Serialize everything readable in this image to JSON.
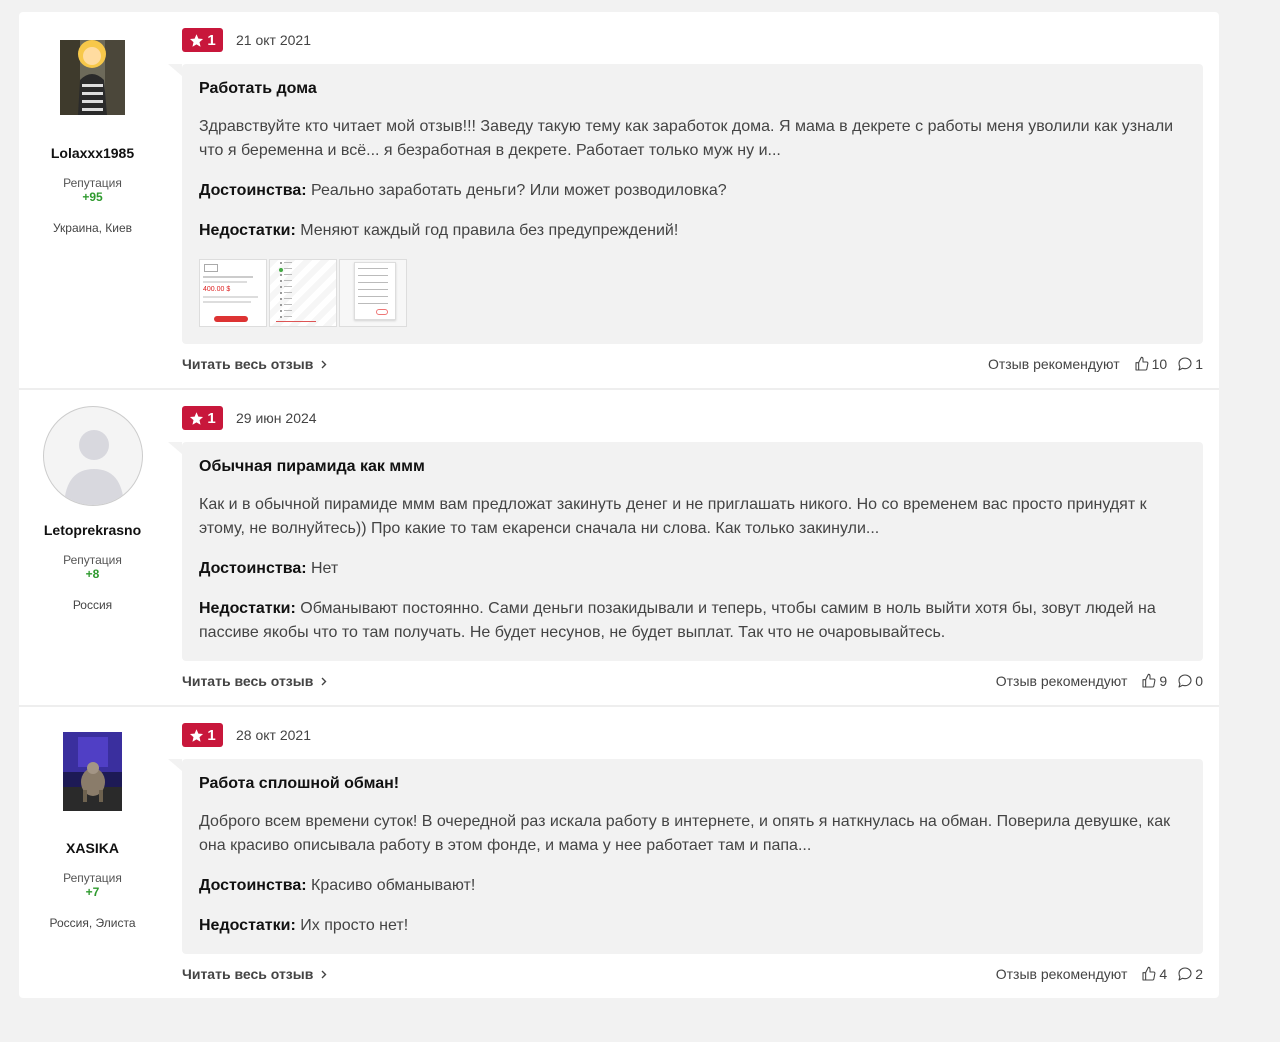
{
  "reviews": [
    {
      "author": {
        "name": "Lolaxxx1985",
        "rep_label": "Репутация",
        "rep_value": "+95",
        "location": "Украина, Киев"
      },
      "rating": "1",
      "date": "21 окт 2021",
      "title": "Работать дома",
      "text": "Здравствуйте кто читает мой отзыв!!! Заведу такую тему как заработок дома. Я мама в декрете с работы меня уволили как узнали что я беременна и всё... я безработная в декрете. Работает только муж ну и...",
      "pros_label": "Достоинства:",
      "pros": "Реально заработать деньги? Или может розводиловка?",
      "cons_label": "Недостатки:",
      "cons": "Меняют каждый год правила без предупреждений!",
      "thumb_text": "400.00 $",
      "read_more": "Читать весь отзыв",
      "rec_label": "Отзыв рекомендуют",
      "likes": "10",
      "comments": "1"
    },
    {
      "author": {
        "name": "Letoprekrasno",
        "rep_label": "Репутация",
        "rep_value": "+8",
        "location": "Россия"
      },
      "rating": "1",
      "date": "29 июн 2024",
      "title": "Обычная пирамида как ммм",
      "text": "Как и в обычной пирамиде ммм вам предложат закинуть денег и не приглашать никого. Но со временем вас просто принудят к этому, не волнуйтесь)) Про какие то там екаренси сначала ни слова. Как только закинули...",
      "pros_label": "Достоинства:",
      "pros": "Нет",
      "cons_label": "Недостатки:",
      "cons": "Обманывают постоянно. Сами деньги позакидывали и теперь, чтобы самим в ноль выйти хотя бы, зовут людей на пассиве якобы что то там получать. Не будет несунов, не будет выплат. Так что не очаровывайтесь.",
      "read_more": "Читать весь отзыв",
      "rec_label": "Отзыв рекомендуют",
      "likes": "9",
      "comments": "0"
    },
    {
      "author": {
        "name": "XASIKA",
        "rep_label": "Репутация",
        "rep_value": "+7",
        "location": "Россия, Элиста"
      },
      "rating": "1",
      "date": "28 окт 2021",
      "title": "Работа сплошной обман!",
      "text": "Доброго всем времени суток! В очередной раз искала работу в интернете, и опять я наткнулась на обман. Поверила девушке, как она красиво описывала работу в этом фонде, и мама у нее работает там и папа...",
      "pros_label": "Достоинства:",
      "pros": "Красиво обманывают!",
      "cons_label": "Недостатки:",
      "cons": "Их просто нет!",
      "read_more": "Читать весь отзыв",
      "rec_label": "Отзыв рекомендуют",
      "likes": "4",
      "comments": "2"
    }
  ],
  "colors": {
    "badge": "#c8173b",
    "reputation": "#2e9a2e",
    "bubble": "#f2f2f2"
  }
}
